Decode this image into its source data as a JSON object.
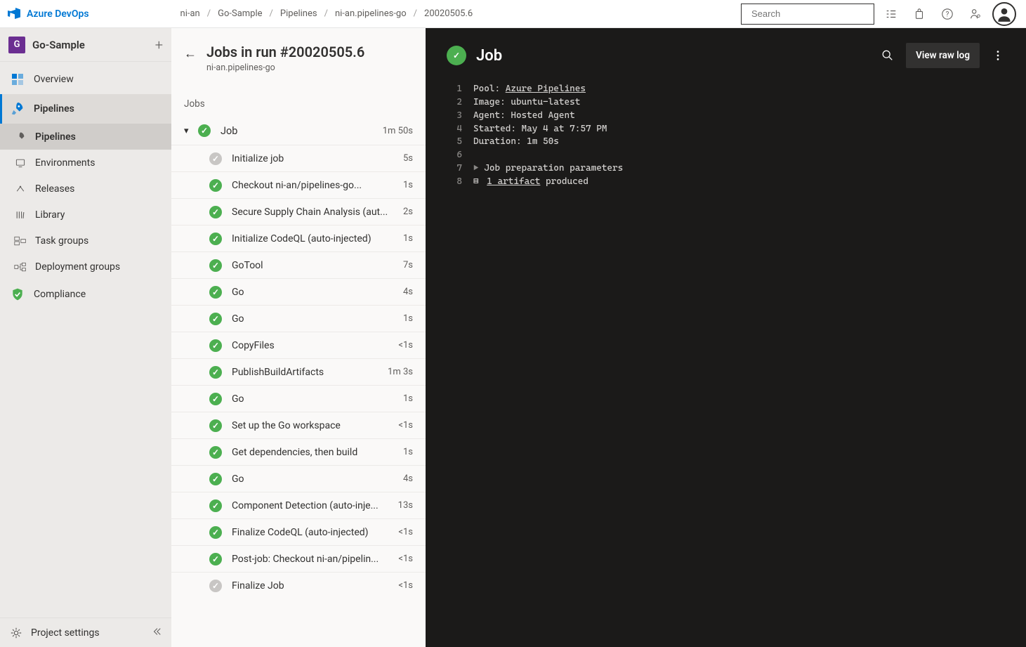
{
  "brand": "Azure DevOps",
  "breadcrumb": [
    "ni-an",
    "Go-Sample",
    "Pipelines",
    "ni-an.pipelines-go",
    "20020505.6"
  ],
  "search": {
    "placeholder": "Search"
  },
  "project": {
    "initial": "G",
    "name": "Go-Sample"
  },
  "nav": {
    "sections": [
      {
        "id": "overview",
        "label": "Overview",
        "icon": "grid-icon"
      },
      {
        "id": "pipelines",
        "label": "Pipelines",
        "icon": "rocket-icon",
        "active": true,
        "children": [
          {
            "id": "pipelines2",
            "label": "Pipelines",
            "icon": "rocket-small-icon",
            "current": true
          },
          {
            "id": "envs",
            "label": "Environments",
            "icon": "env-icon"
          },
          {
            "id": "releases",
            "label": "Releases",
            "icon": "release-icon"
          },
          {
            "id": "library",
            "label": "Library",
            "icon": "library-icon"
          },
          {
            "id": "taskgroups",
            "label": "Task groups",
            "icon": "taskgroup-icon"
          },
          {
            "id": "depgroups",
            "label": "Deployment groups",
            "icon": "depgroup-icon"
          }
        ]
      },
      {
        "id": "compliance",
        "label": "Compliance",
        "icon": "shield-icon"
      }
    ],
    "footer": "Project settings"
  },
  "run": {
    "title": "Jobs in run #20020505.6",
    "subtitle": "ni-an.pipelines-go",
    "jobs_label": "Jobs",
    "job": {
      "name": "Job",
      "duration": "1m 50s"
    },
    "steps": [
      {
        "name": "Initialize job",
        "dur": "5s",
        "status": "neutral"
      },
      {
        "name": "Checkout ni-an/pipelines-go...",
        "dur": "1s",
        "status": "success"
      },
      {
        "name": "Secure Supply Chain Analysis (aut...",
        "dur": "2s",
        "status": "success"
      },
      {
        "name": "Initialize CodeQL (auto-injected)",
        "dur": "1s",
        "status": "success"
      },
      {
        "name": "GoTool",
        "dur": "7s",
        "status": "success"
      },
      {
        "name": "Go",
        "dur": "4s",
        "status": "success"
      },
      {
        "name": "Go",
        "dur": "1s",
        "status": "success"
      },
      {
        "name": "CopyFiles",
        "dur": "<1s",
        "status": "success"
      },
      {
        "name": "PublishBuildArtifacts",
        "dur": "1m 3s",
        "status": "success"
      },
      {
        "name": "Go",
        "dur": "1s",
        "status": "success"
      },
      {
        "name": "Set up the Go workspace",
        "dur": "<1s",
        "status": "success"
      },
      {
        "name": "Get dependencies, then build",
        "dur": "1s",
        "status": "success"
      },
      {
        "name": "Go",
        "dur": "4s",
        "status": "success"
      },
      {
        "name": "Component Detection (auto-inje...",
        "dur": "13s",
        "status": "success"
      },
      {
        "name": "Finalize CodeQL (auto-injected)",
        "dur": "<1s",
        "status": "success"
      },
      {
        "name": "Post-job: Checkout ni-an/pipelin...",
        "dur": "<1s",
        "status": "success"
      },
      {
        "name": "Finalize Job",
        "dur": "<1s",
        "status": "neutral"
      }
    ]
  },
  "logpanel": {
    "title": "Job",
    "view_raw": "View raw log",
    "lines": {
      "l1_pre": "Pool: ",
      "l1_link": "Azure Pipelines",
      "l2": "Image: ubuntu-latest",
      "l3": "Agent: Hosted Agent",
      "l4": "Started: May 4 at 7:57 PM",
      "l5": "Duration: 1m 50s",
      "l7": "Job preparation parameters",
      "l8_link": "1 artifact",
      "l8_post": " produced"
    }
  }
}
